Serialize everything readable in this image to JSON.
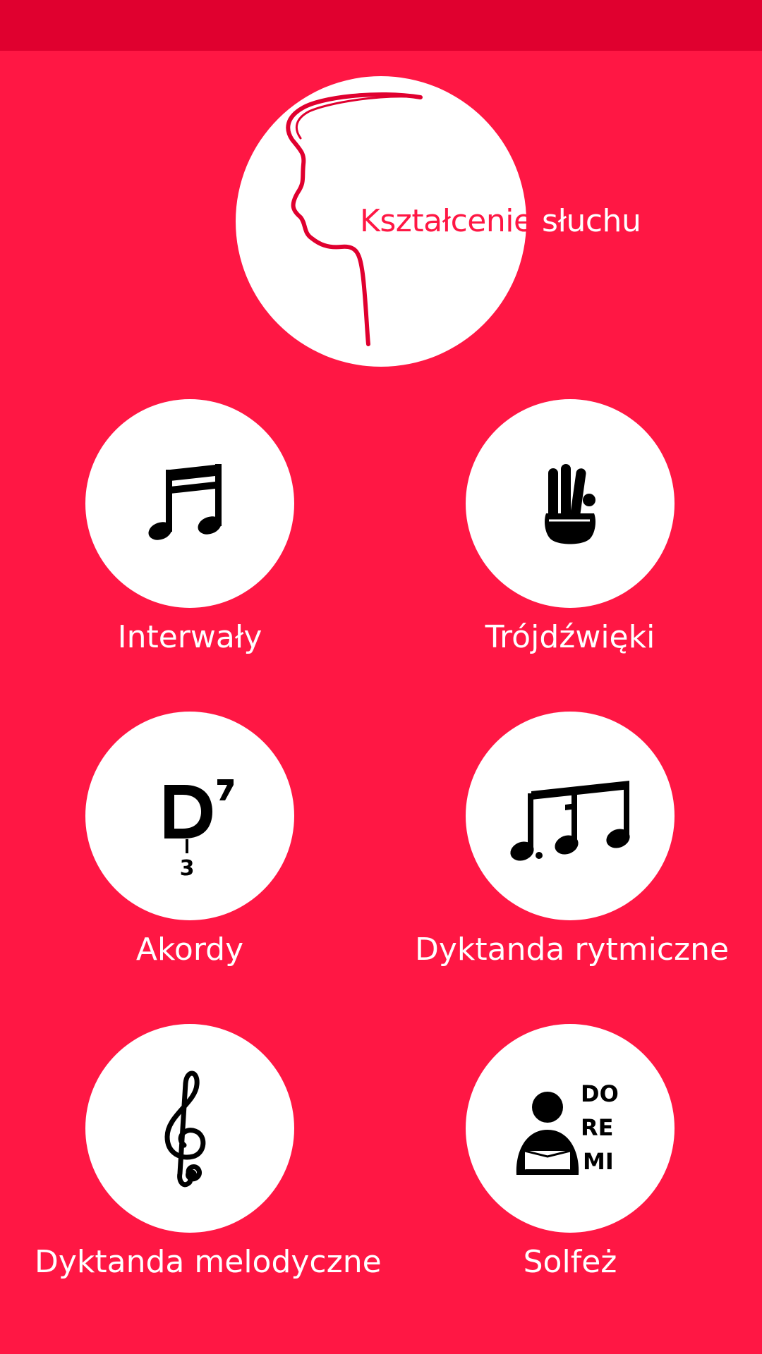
{
  "app": {
    "title_part1": "Kształcenie",
    "title_part2": "słuchu",
    "logo_icon": "head-profile-icon"
  },
  "colors": {
    "background": "#FF1744",
    "statusbar": "#E0002F",
    "circle": "#FFFFFF",
    "icon": "#000000"
  },
  "menu": [
    {
      "label": "Interwały",
      "icon": "beamed-notes-icon"
    },
    {
      "label": "Trójdźwięki",
      "icon": "three-fingers-hand-icon"
    },
    {
      "label": "Akordy",
      "icon": "dominant-seventh-chord-icon"
    },
    {
      "label": "Dyktanda rytmiczne",
      "icon": "rhythm-notes-icon"
    },
    {
      "label": "Dyktanda melodyczne",
      "icon": "treble-clef-icon"
    },
    {
      "label": "Solfeż",
      "icon": "singer-doremi-icon"
    }
  ]
}
